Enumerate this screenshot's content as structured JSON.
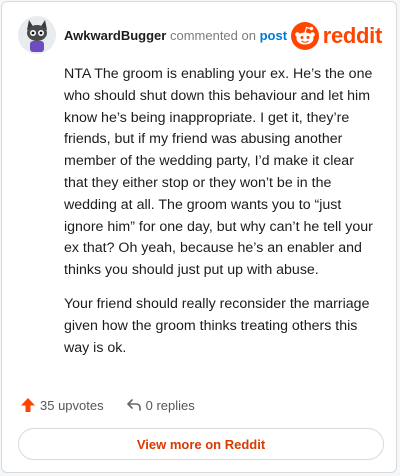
{
  "embed": {
    "author": "AwkwardBugger",
    "action_text": "commented on",
    "post_link": "post",
    "brand": "reddit",
    "brand_color": "#ff4500",
    "comment_paragraphs": [
      "NTA The groom is enabling your ex. He’s the one who should shut down this behaviour and let him know he’s being inappropriate. I get it, they’re friends, but if my friend was abusing another member of the wedding party, I’d make it clear that they either stop or they won’t be in the wedding at all. The groom wants you to “just ignore him” for one day, but why can’t he tell your ex that? Oh yeah, because he’s an enabler and thinks you should just put up with abuse.",
      "Your friend should really reconsider the marriage given how the groom thinks treating others this way is ok."
    ],
    "upvotes": "35 upvotes",
    "replies": "0 replies",
    "view_more": "View more on Reddit",
    "icons": {
      "upvote": "upvote-arrow-icon",
      "reply": "reply-arrow-icon",
      "brand": "reddit-snoo-icon"
    }
  }
}
